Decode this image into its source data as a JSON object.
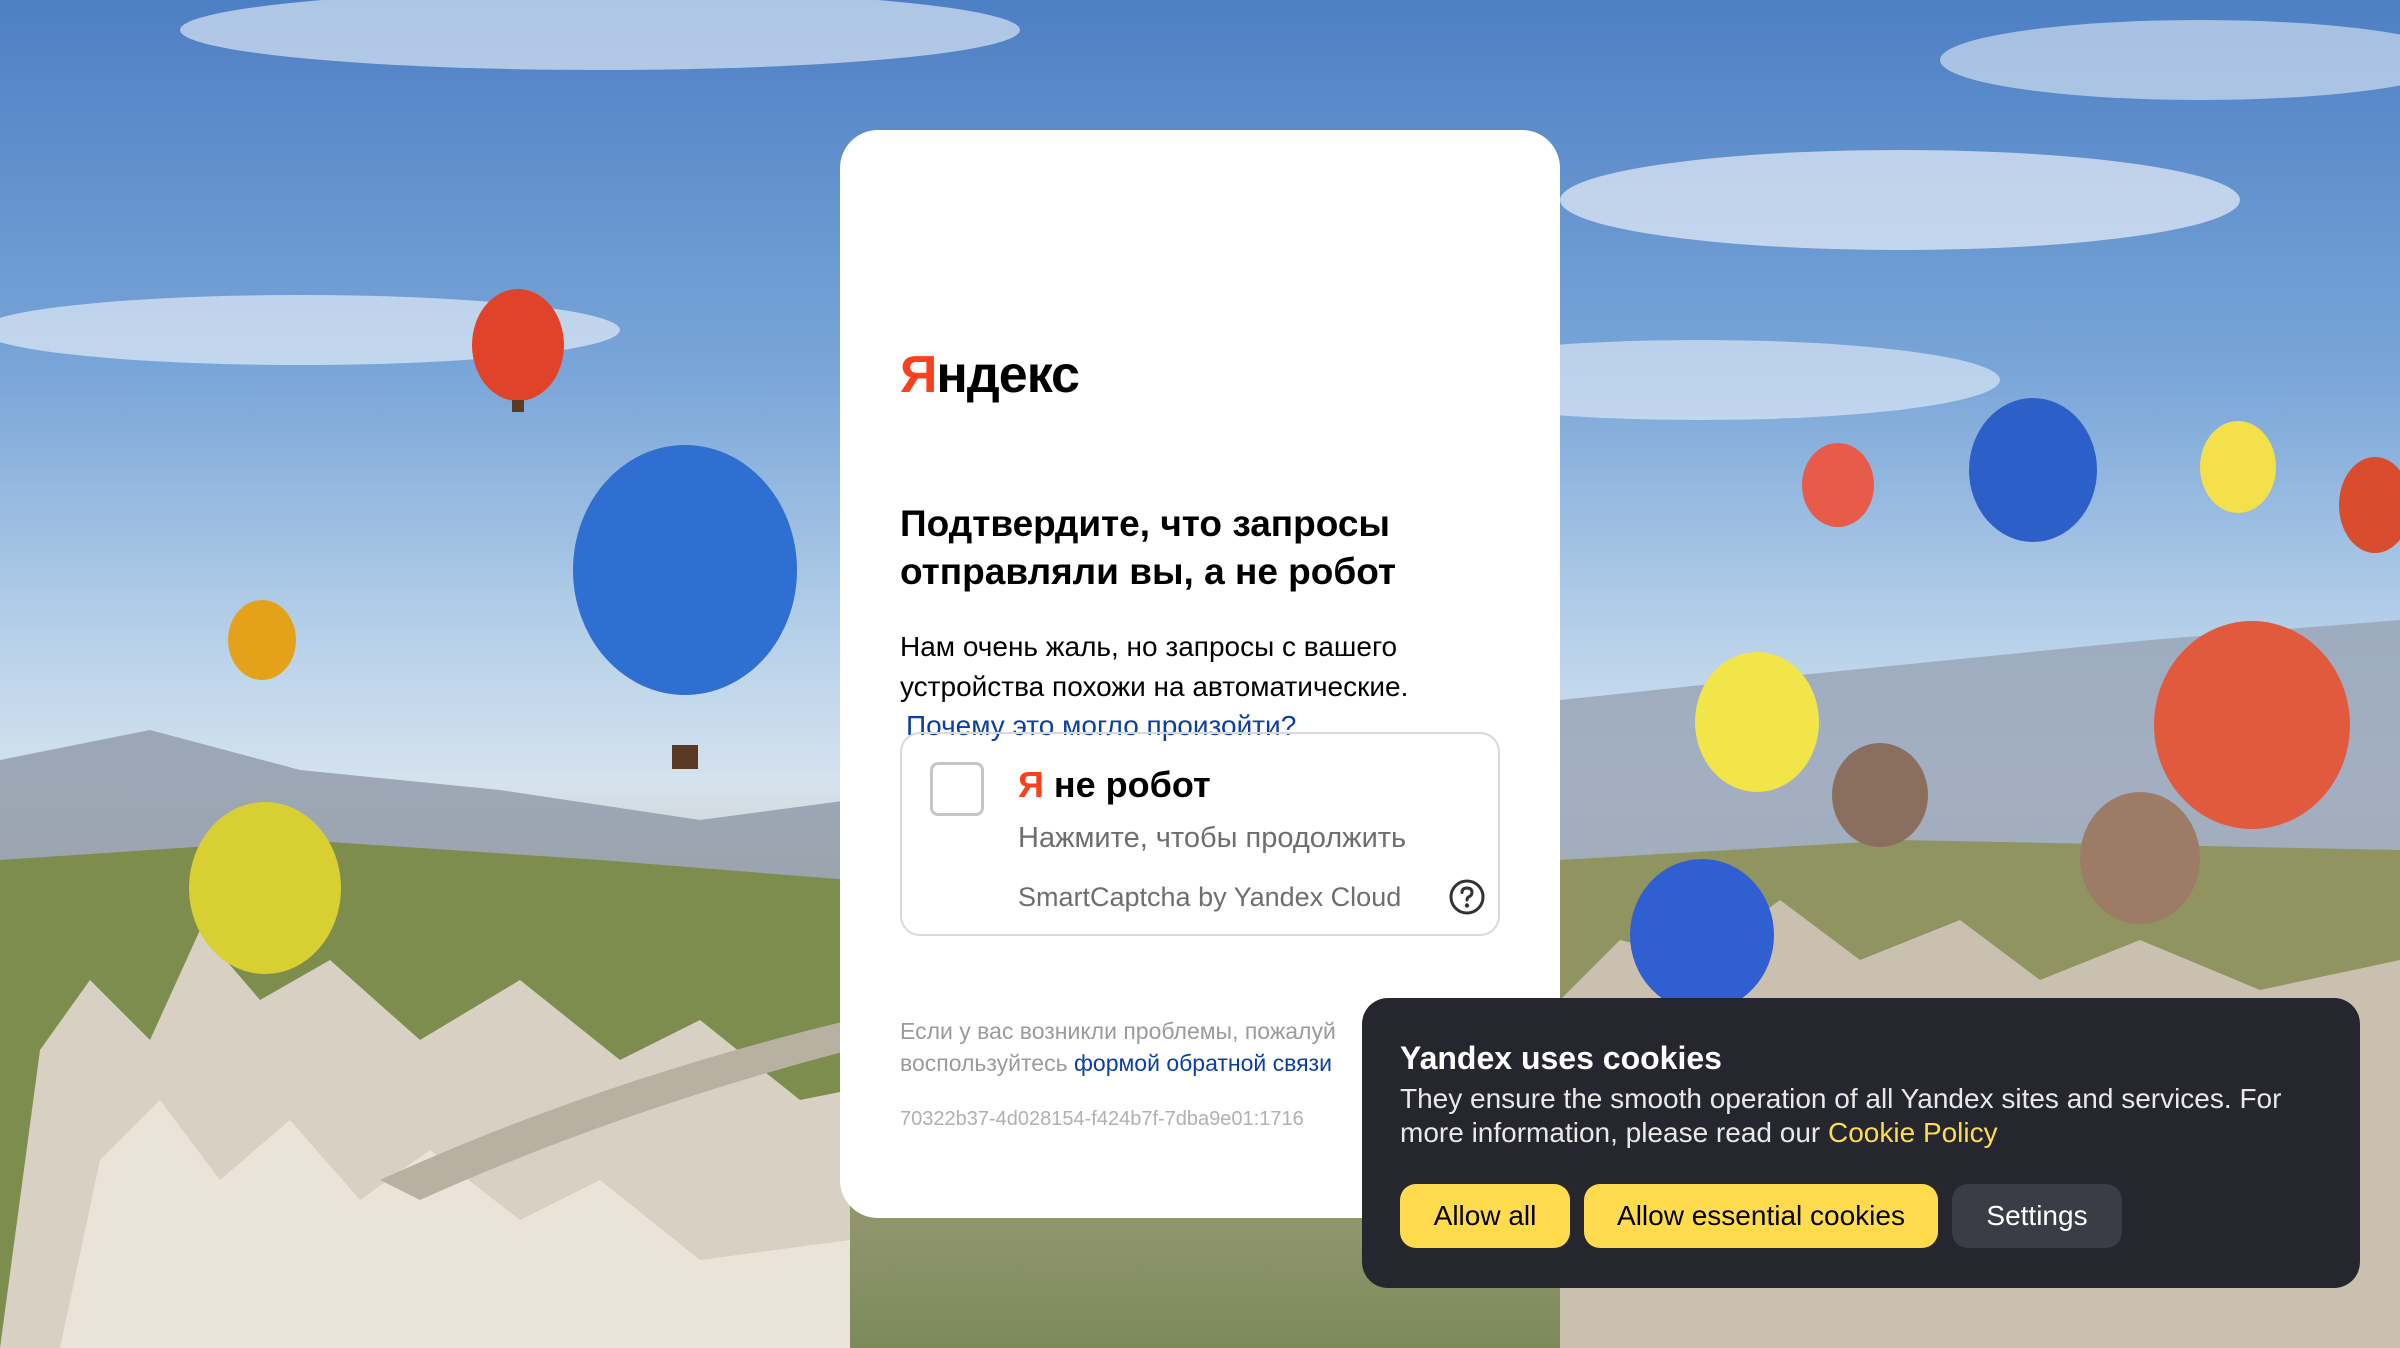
{
  "background": {
    "description_icon": "hot-air-balloons-landscape"
  },
  "captcha_page": {
    "logo": {
      "first_letter": "Я",
      "rest": "ндекс"
    },
    "title": "Подтвердите, что запросы отправляли вы, а не робот",
    "description": "Нам очень жаль, но запросы с вашего устройства похожи на автоматические.",
    "why_link": "Почему это могло произойти?",
    "widget": {
      "title_ya": "Я",
      "title_rest": " не робот",
      "subtitle": "Нажмите, чтобы продолжить",
      "brand": "SmartCaptcha by Yandex Cloud",
      "help_icon": "question-circle-icon"
    },
    "problem_text_before": "Если у вас возникли проблемы, пожалуй",
    "problem_text_line2": "воспользуйтесь ",
    "feedback_link": "формой обратной связи",
    "request_id": "70322b37-4d028154-f424b7f-7dba9e01:1716"
  },
  "cookie_banner": {
    "title": "Yandex uses cookies",
    "text": "They ensure the smooth operation of all Yandex sites and services. For more information, please read our ",
    "policy_link": "Cookie Policy",
    "buttons": {
      "allow_all": "Allow all",
      "allow_essential": "Allow essential cookies",
      "settings": "Settings"
    },
    "colors": {
      "accent": "#ffdb4d",
      "background": "#25262e"
    }
  },
  "colors": {
    "brand_red": "#fc3f1d",
    "link_blue": "#0b3ea8"
  }
}
